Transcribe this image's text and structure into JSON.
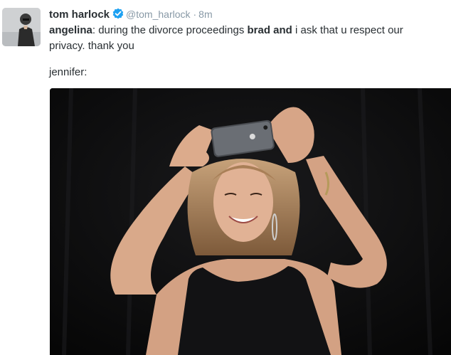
{
  "tweet": {
    "author": {
      "name": "tom harlock",
      "handle": "@tom_harlock",
      "verified": true,
      "avatar_icon": "profile-photo"
    },
    "separator": "·",
    "time": "8m",
    "text": {
      "speaker1": "angelina",
      "part1": ": during the divorce proceedings ",
      "bold_phrase": "brad and",
      "part2": " i ask that u respect our",
      "line2": "privacy. thank you",
      "line3": "jennifer:"
    },
    "media": {
      "type": "photo",
      "description_icon": "photo-woman-taking-selfie-icon"
    }
  },
  "colors": {
    "text": "#292f33",
    "meta": "#8899a6",
    "verified": "#1da1f2",
    "photo_bg": "#0b0b0c"
  }
}
